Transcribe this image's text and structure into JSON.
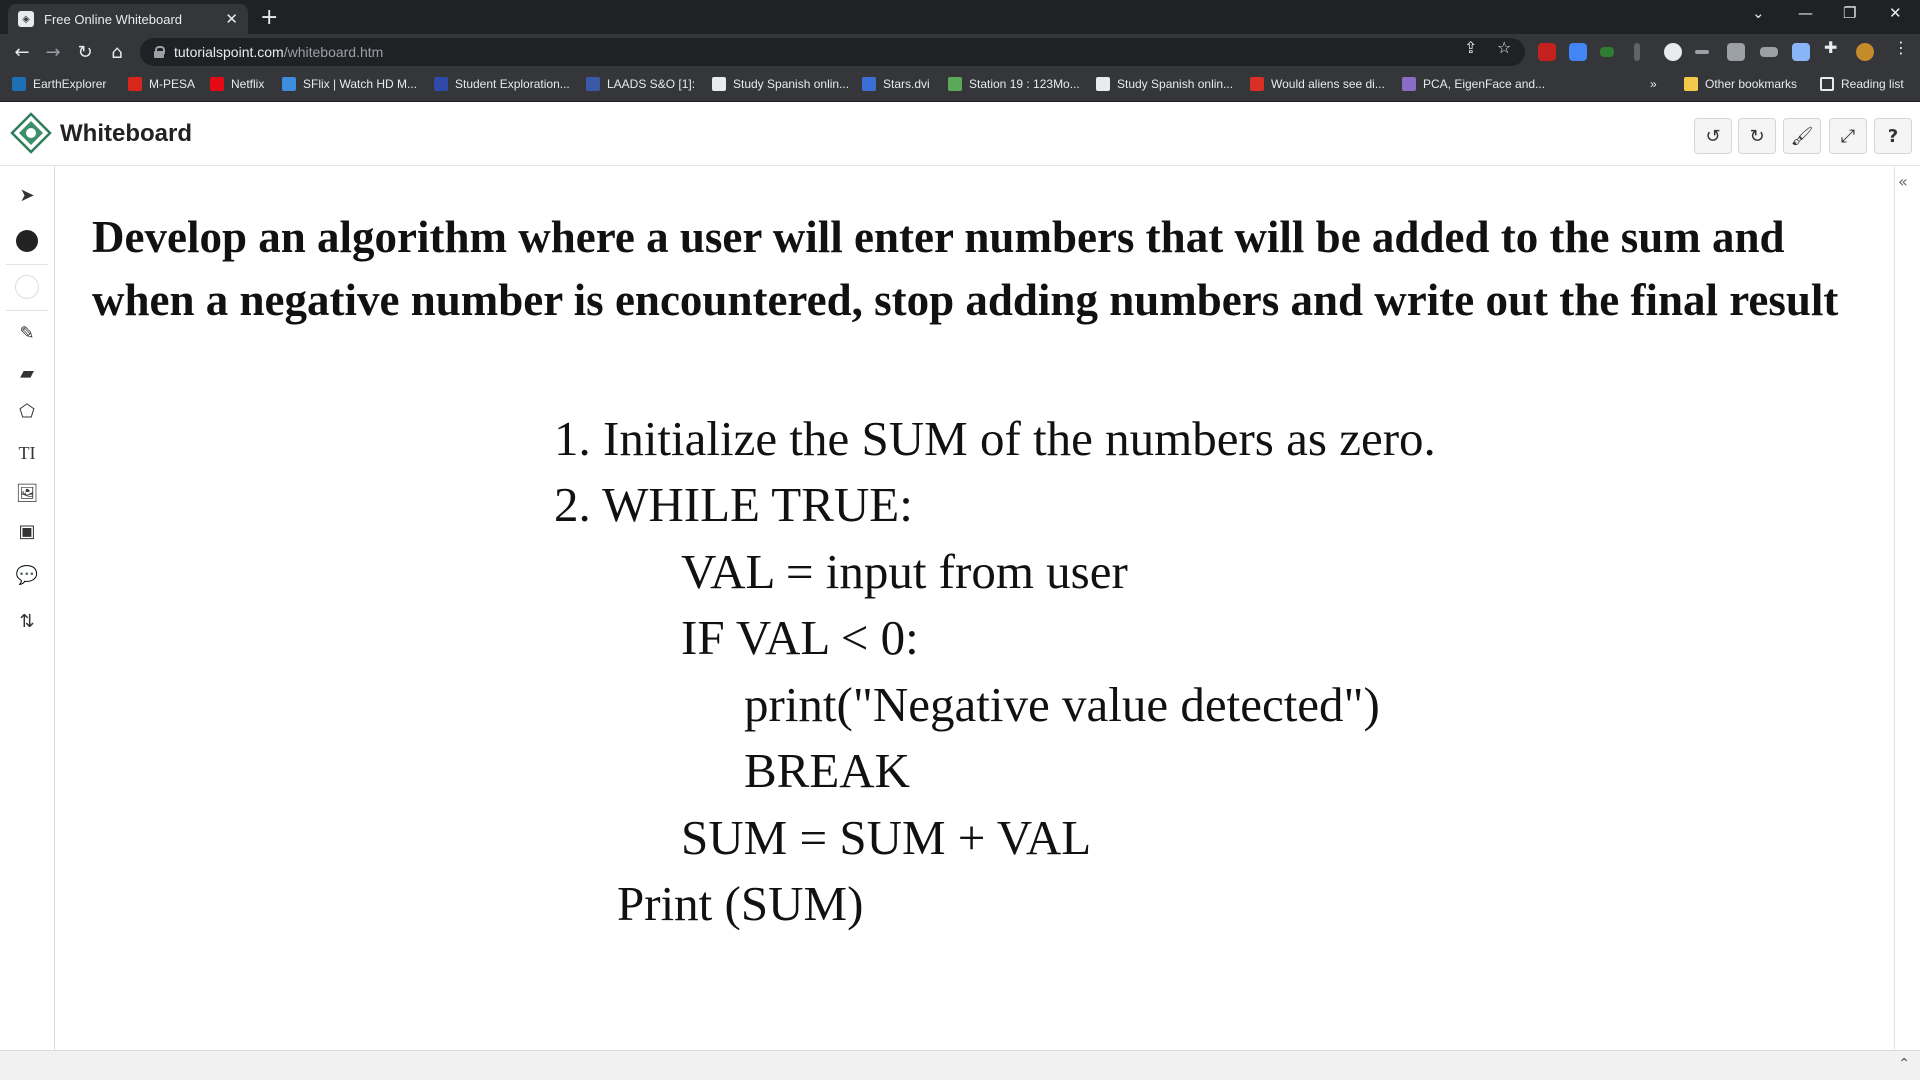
{
  "browser": {
    "tab_title": "Free Online Whiteboard",
    "tab_close": "✕",
    "new_tab": "+",
    "url_host": "tutorialspoint.com",
    "url_path": "/whiteboard.htm",
    "bookmarks": [
      {
        "label": "EarthExplorer",
        "color": "#1f6fb5"
      },
      {
        "label": "M-PESA",
        "color": "#d9261c"
      },
      {
        "label": "Netflix",
        "color": "#e50914"
      },
      {
        "label": "SFlix | Watch HD M...",
        "color": "#3c8dde"
      },
      {
        "label": "Student Exploration...",
        "color": "#2f4aa8"
      },
      {
        "label": "LAADS S&O [1]:",
        "color": "#3b5aa6"
      },
      {
        "label": "Study Spanish onlin...",
        "color": "#e8eaed"
      },
      {
        "label": "Stars.dvi",
        "color": "#3a6fd8"
      },
      {
        "label": "Station 19 : 123Mo...",
        "color": "#5aa95a"
      },
      {
        "label": "Study Spanish onlin...",
        "color": "#e8eaed"
      },
      {
        "label": "Would aliens see di...",
        "color": "#d93025"
      },
      {
        "label": "PCA, EigenFace and...",
        "color": "#8a6cc7"
      }
    ],
    "bookmarks_overflow": "»",
    "other_bookmarks": "Other bookmarks",
    "reading_list": "Reading list"
  },
  "app": {
    "title": "Whiteboard"
  },
  "icons": {
    "undo": "↺",
    "redo": "↻",
    "brush": "🖌",
    "fullscreen": "⤢",
    "help": "?",
    "flyout_add": "+",
    "flyout_delete": "🗑",
    "flyout_menu": "≡",
    "text_tool": "TI",
    "collapse": "«",
    "scroll_up": "⌃"
  },
  "board": {
    "heading": "Develop an algorithm where a user will enter numbers that will be added to the sum and when a negative number is encountered, stop adding numbers and write out the final result",
    "lines": [
      "1. Initialize the SUM of the numbers as zero.",
      "2. WHILE TRUE:",
      "VAL = input from user",
      "IF VAL < 0:",
      "print(\"Negative value detected\")",
      "BREAK",
      "SUM = SUM + VAL",
      "Print (SUM)"
    ]
  },
  "colors": {
    "chrome_dark": "#202124",
    "chrome_mid": "#35363a",
    "chrome_text": "#e8eaed",
    "canvas_bg": "#ffffff",
    "ink": "#111111"
  }
}
